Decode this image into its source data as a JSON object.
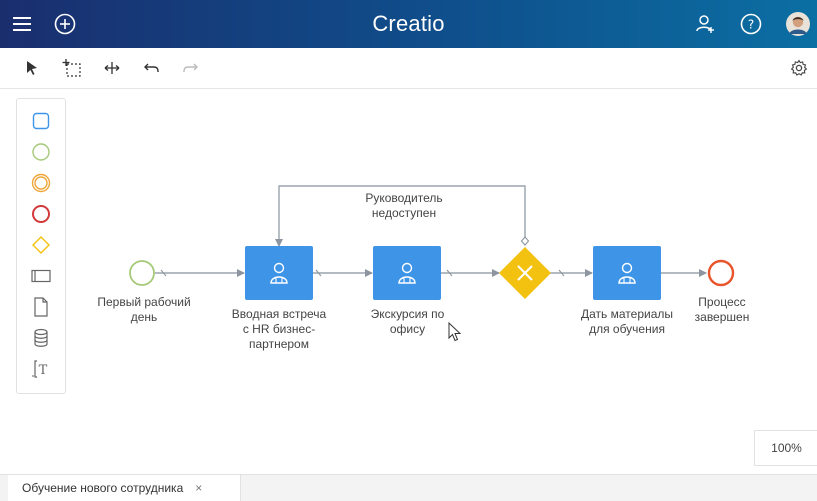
{
  "app": {
    "logo_text": "Creatio"
  },
  "header": {
    "icons": [
      "menu-icon",
      "add-icon",
      "user-add-icon",
      "help-icon",
      "avatar"
    ]
  },
  "toolbar": {
    "tools": [
      "pointer-icon",
      "selection-icon",
      "move-icon",
      "undo-icon",
      "redo-icon",
      "settings-icon"
    ]
  },
  "palette": {
    "items": [
      "task-icon",
      "start-event-icon",
      "intermediate-event-icon",
      "end-event-icon",
      "gateway-icon",
      "subprocess-icon",
      "document-icon",
      "database-icon",
      "annotation-icon"
    ]
  },
  "diagram": {
    "start_label": "Первый рабочий\nдень",
    "task1_label": "Вводная встреча\nс HR бизнес-\nпартнером",
    "task2_label": "Экскурсия по\nофису",
    "loop_label": "Руководитель\nнедоступен",
    "task3_label": "Дать материалы\nдля обучения",
    "end_label": "Процесс\nзавершен"
  },
  "zoom": {
    "value": "100%"
  },
  "tabs": [
    {
      "label": "Обучение нового сотрудника",
      "close": "×"
    }
  ],
  "colors": {
    "header_start": "#1a2e6e",
    "header_end": "#0b6fa3",
    "task_fill": "#3e95e8",
    "gateway_fill": "#f3c211",
    "start_event": "#7cb342",
    "end_event": "#e8542c",
    "connector": "#9aa3ad"
  }
}
